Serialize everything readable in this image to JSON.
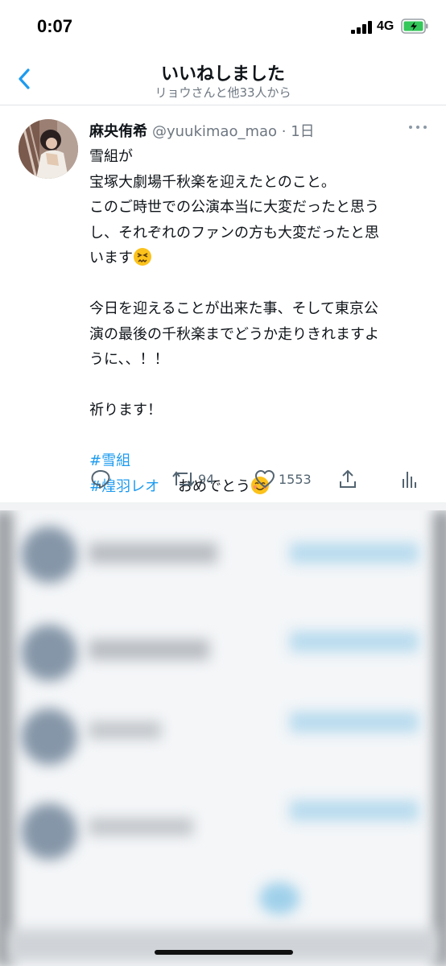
{
  "status_bar": {
    "time": "0:07",
    "network": "4G",
    "battery_icon": "battery-charging-icon"
  },
  "header": {
    "title": "いいねしました",
    "subtitle": "リョウさんと他33人から"
  },
  "tweet": {
    "display_name": "麻央侑希",
    "handle_time": "@yuukimao_mao · 1日",
    "lines": [
      "雪組が",
      "宝塚大劇場千秋楽を迎えたとのこと。",
      "このご時世での公演本当に大変だったと思う",
      "し、それぞれのファンの方も大変だったと思",
      "います"
    ],
    "paragraph2": [
      "今日を迎えることが出来た事、そして東京公",
      "演の最後の千秋楽までどうか走りきれますよ",
      "うに、、！！"
    ],
    "paragraph3": "祈ります！",
    "hashtags": [
      "#雪組",
      "#煌羽レオ"
    ],
    "closing_text": "おめでとう",
    "emojis": [
      "persevering-face-emoji",
      "smiling-face-emoji"
    ]
  },
  "actions": {
    "retweets": "94",
    "likes": "1553"
  },
  "colors": {
    "accent": "#1d9bf0",
    "muted": "#6e7781",
    "icon": "#536471"
  }
}
